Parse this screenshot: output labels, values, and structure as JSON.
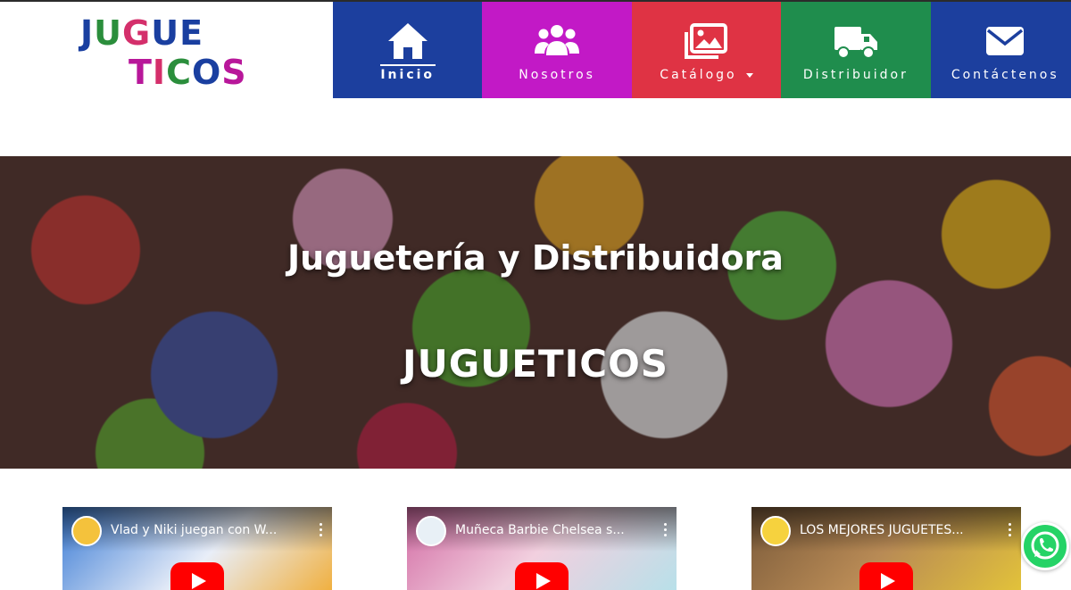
{
  "logo": {
    "line1": [
      {
        "ch": "J",
        "color": "#1a3fa0"
      },
      {
        "ch": "U",
        "color": "#2b8e3c"
      },
      {
        "ch": "G",
        "color": "#d42f6b"
      },
      {
        "ch": "U",
        "color": "#1a3fa0"
      },
      {
        "ch": "E",
        "color": "#1a3fa0"
      }
    ],
    "line2": [
      {
        "ch": "T",
        "color": "#b8179a"
      },
      {
        "ch": "I",
        "color": "#d42f6b"
      },
      {
        "ch": "C",
        "color": "#2b8e3c"
      },
      {
        "ch": "O",
        "color": "#1a3fa0"
      },
      {
        "ch": "S",
        "color": "#b8179a"
      }
    ]
  },
  "nav": {
    "items": [
      {
        "label": "Inicio",
        "icon": "home-icon",
        "color": "#1c3f9e",
        "active": true
      },
      {
        "label": "Nosotros",
        "icon": "users-icon",
        "color": "#c219c6",
        "active": false
      },
      {
        "label": "Catálogo",
        "icon": "images-icon",
        "color": "#df3344",
        "active": false,
        "dropdown": true
      },
      {
        "label": "Distribuidor",
        "icon": "truck-icon",
        "color": "#1f8d4d",
        "active": false
      },
      {
        "label": "Contáctenos",
        "icon": "envelope-icon",
        "color": "#1c3f9e",
        "active": false
      }
    ]
  },
  "hero": {
    "title": "Juguetería y Distribuidora",
    "subtitle": "JUGUETICOS"
  },
  "videos": [
    {
      "title": "Vlad y Niki juegan con W...",
      "thumb_color": "#3a7bd5"
    },
    {
      "title": "Muñeca Barbie Chelsea s...",
      "thumb_color": "#d26aa3"
    },
    {
      "title": "LOS MEJORES JUGUETES...",
      "thumb_color": "#7a5a3a"
    }
  ],
  "whatsapp": {
    "icon": "whatsapp-icon",
    "color": "#25d366"
  }
}
